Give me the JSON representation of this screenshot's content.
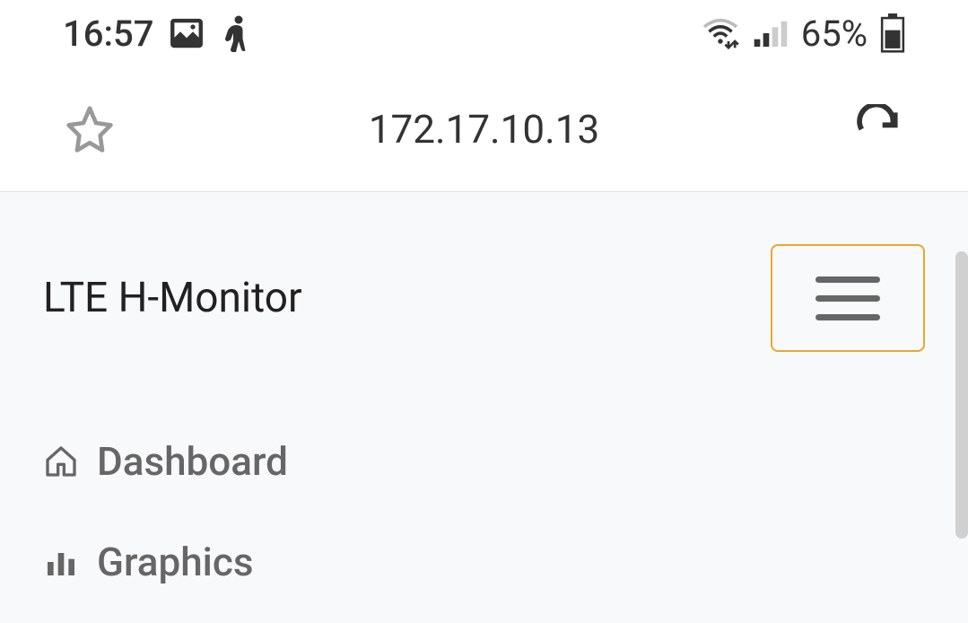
{
  "status_bar": {
    "time": "16:57",
    "battery_percent": "65%"
  },
  "browser": {
    "url": "172.17.10.13"
  },
  "app": {
    "title": "LTE H-Monitor"
  },
  "nav": {
    "items": [
      {
        "label": "Dashboard"
      },
      {
        "label": "Graphics"
      }
    ]
  }
}
